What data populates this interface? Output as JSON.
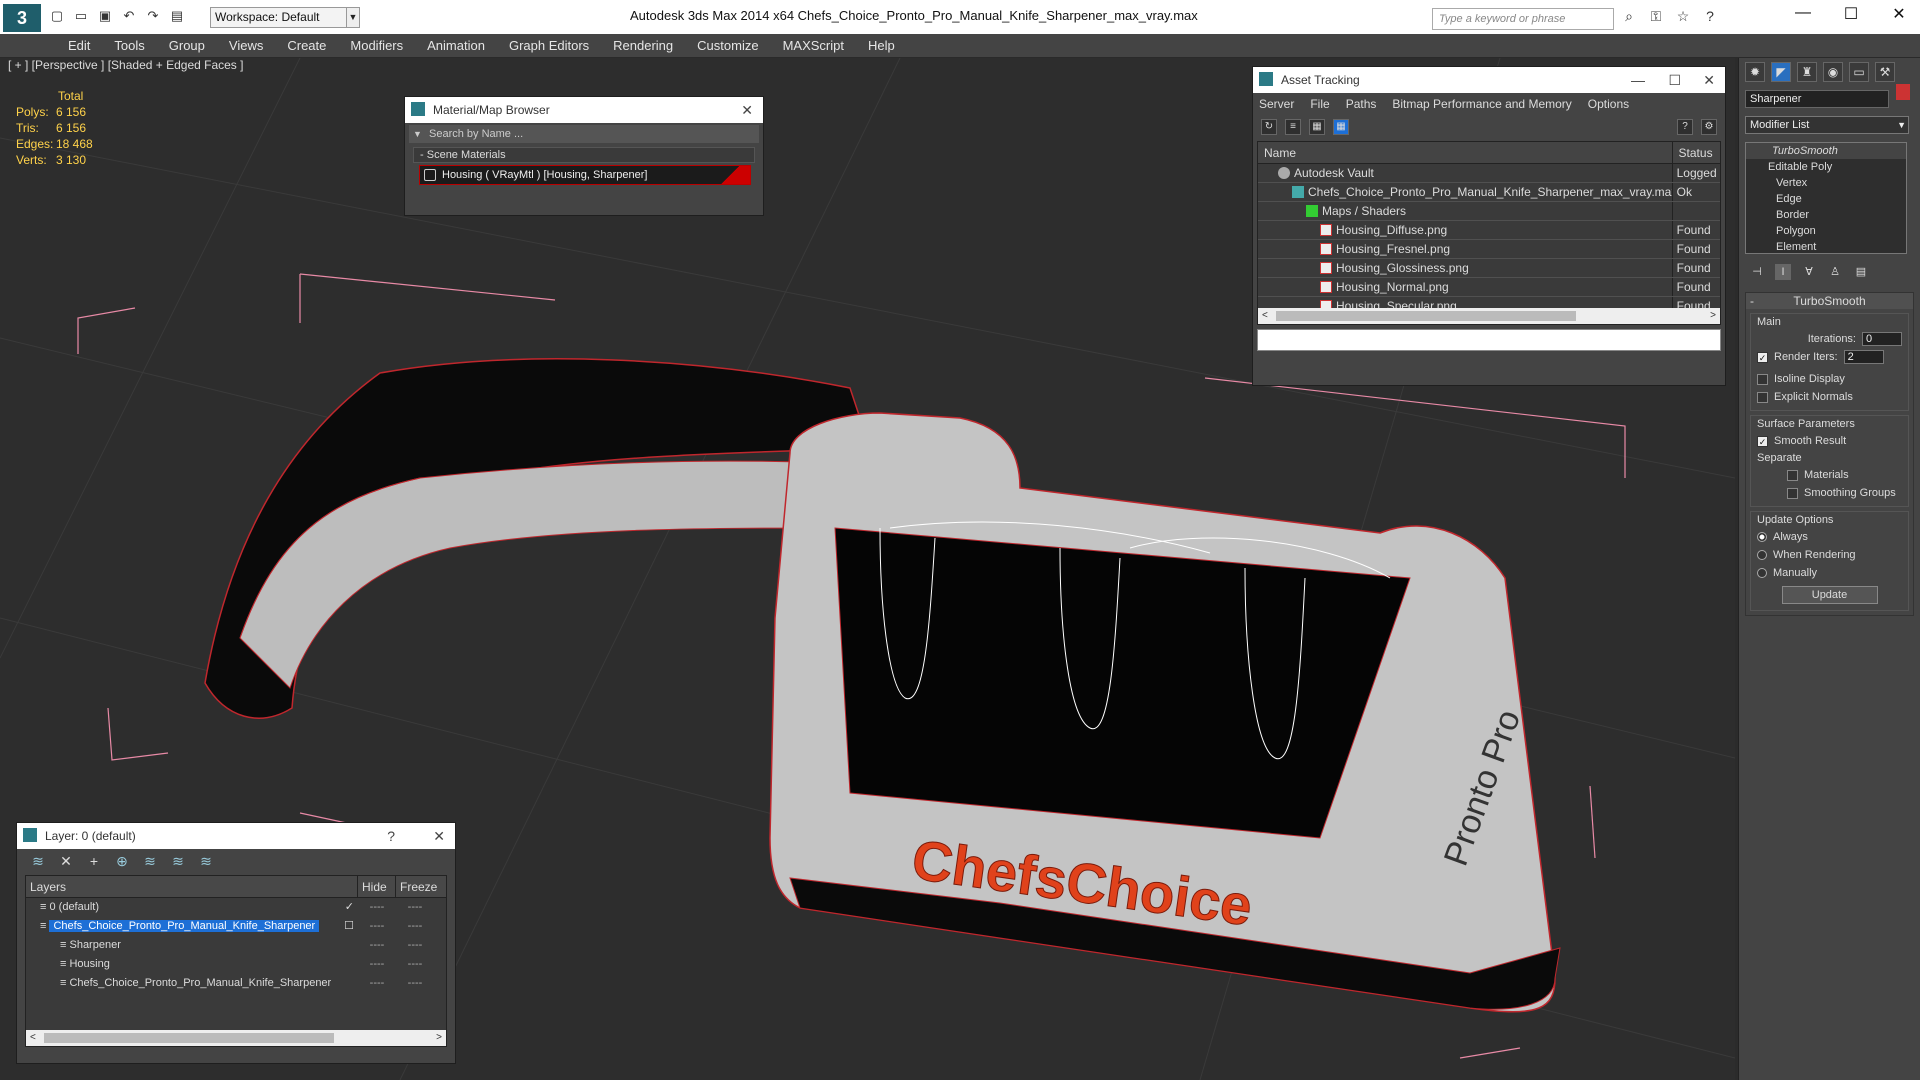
{
  "titlebar": {
    "logo": "3",
    "workspace": "Workspace: Default",
    "app_title": "Autodesk 3ds Max  2014 x64      Chefs_Choice_Pronto_Pro_Manual_Knife_Sharpener_max_vray.max",
    "search_placeholder": "Type a keyword or phrase",
    "win_min": "—",
    "win_max": "☐",
    "win_close": "✕"
  },
  "menu": [
    "Edit",
    "Tools",
    "Group",
    "Views",
    "Create",
    "Modifiers",
    "Animation",
    "Graph Editors",
    "Rendering",
    "Customize",
    "MAXScript",
    "Help"
  ],
  "viewport": {
    "label": "[ + ] [Perspective ] [Shaded + Edged Faces ]",
    "stats": {
      "header": "Total",
      "rows": [
        {
          "k": "Polys:",
          "v": "6 156"
        },
        {
          "k": "Tris:",
          "v": "6 156"
        },
        {
          "k": "Edges:",
          "v": "18 468"
        },
        {
          "k": "Verts:",
          "v": "3 130"
        }
      ]
    }
  },
  "material_browser": {
    "title": "Material/Map Browser",
    "search_placeholder": "Search by Name ...",
    "section": "Scene Materials",
    "item": "Housing  ( VRayMtl )  [Housing, Sharpener]"
  },
  "asset_tracking": {
    "title": "Asset Tracking",
    "menus": [
      "Server",
      "File",
      "Paths",
      "Bitmap Performance and Memory",
      "Options"
    ],
    "col_name": "Name",
    "col_status": "Status",
    "rows": [
      {
        "name": "Autodesk Vault",
        "status": "Logged",
        "icon": "vault-icon",
        "indent": 20
      },
      {
        "name": "Chefs_Choice_Pronto_Pro_Manual_Knife_Sharpener_max_vray.max",
        "status": "Ok",
        "icon": "max-file-icon",
        "indent": 34
      },
      {
        "name": "Maps / Shaders",
        "status": "",
        "icon": "folder-icon",
        "indent": 48
      },
      {
        "name": "Housing_Diffuse.png",
        "status": "Found",
        "icon": "png-icon",
        "indent": 62
      },
      {
        "name": "Housing_Fresnel.png",
        "status": "Found",
        "icon": "png-icon",
        "indent": 62
      },
      {
        "name": "Housing_Glossiness.png",
        "status": "Found",
        "icon": "png-icon",
        "indent": 62
      },
      {
        "name": "Housing_Normal.png",
        "status": "Found",
        "icon": "png-icon",
        "indent": 62
      },
      {
        "name": "Housing_Specular.png",
        "status": "Found",
        "icon": "png-icon",
        "indent": 62
      }
    ]
  },
  "layers": {
    "title": "Layer: 0 (default)",
    "help": "?",
    "col_layers": "Layers",
    "col_hide": "Hide",
    "col_freeze": "Freeze",
    "rows": [
      {
        "name": "0 (default)",
        "indent": 14,
        "sel": false,
        "check": "✓"
      },
      {
        "name": "Chefs_Choice_Pronto_Pro_Manual_Knife_Sharpener",
        "indent": 14,
        "sel": true,
        "check": "☐"
      },
      {
        "name": "Sharpener",
        "indent": 34,
        "sel": false,
        "check": ""
      },
      {
        "name": "Housing",
        "indent": 34,
        "sel": false,
        "check": ""
      },
      {
        "name": "Chefs_Choice_Pronto_Pro_Manual_Knife_Sharpener",
        "indent": 34,
        "sel": false,
        "check": ""
      }
    ],
    "dash": "----"
  },
  "command_panel": {
    "object_name": "Sharpener",
    "object_color": "#cc3333",
    "modifier_list": "Modifier List",
    "stack": [
      {
        "label": "TurboSmooth",
        "kind": "top"
      },
      {
        "label": "Editable Poly",
        "kind": "main"
      },
      {
        "label": "Vertex",
        "kind": "sub"
      },
      {
        "label": "Edge",
        "kind": "sub"
      },
      {
        "label": "Border",
        "kind": "sub"
      },
      {
        "label": "Polygon",
        "kind": "sub"
      },
      {
        "label": "Element",
        "kind": "sub"
      }
    ],
    "rollout_title": "TurboSmooth",
    "main": {
      "label": "Main",
      "iterations_label": "Iterations:",
      "iterations": "0",
      "render_iters_label": "Render Iters:",
      "render_iters": "2",
      "isoline": "Isoline Display",
      "explicit": "Explicit Normals"
    },
    "surface": {
      "label": "Surface Parameters",
      "smooth_result": "Smooth Result",
      "separate": "Separate",
      "materials": "Materials",
      "smoothing_groups": "Smoothing Groups"
    },
    "update": {
      "label": "Update Options",
      "always": "Always",
      "when_rendering": "When Rendering",
      "manually": "Manually",
      "button": "Update"
    }
  },
  "model_text": {
    "brand": "ChefsChoice",
    "side": "Pronto Pro"
  },
  "colors": {
    "wire": "#c0272d",
    "accent": "#1d6fd6"
  }
}
